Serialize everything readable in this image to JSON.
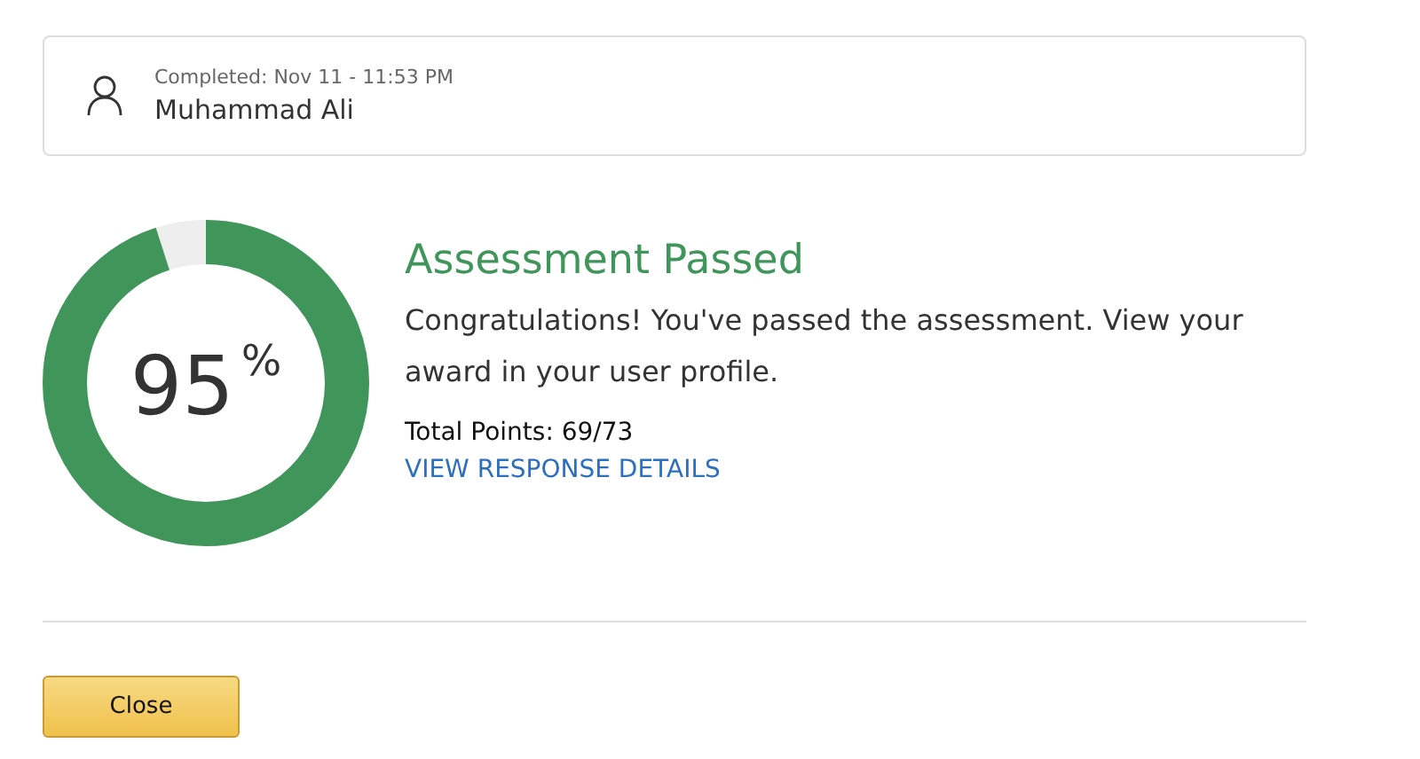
{
  "submission": {
    "completed": "Completed: Nov 11 - 11:53 PM",
    "name": "Muhammad Ali"
  },
  "result": {
    "percent": "95$^{%}$",
    "title": "Assessment Passed",
    "message": "Congratulations! You've passed the assessment. View your award in your user profile.",
    "points": "Total Points: 69/73",
    "link": "VIEW RESPONSE DETAILS"
  },
  "buttons": [
    "Close"
  ]
}
